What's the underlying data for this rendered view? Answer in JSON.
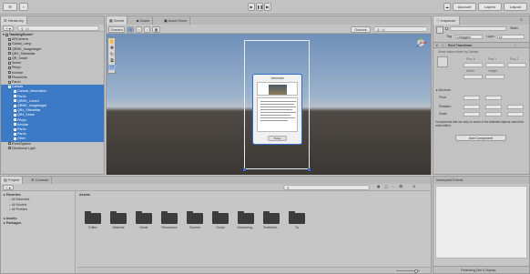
{
  "toolbar": {
    "account_label": "Account",
    "layers_label": "Layers",
    "layout_label": "Layout",
    "play_icon": "play-icon",
    "pause_icon": "pause-icon",
    "step_icon": "step-icon"
  },
  "hierarchy": {
    "tab_label": "Hierarchy",
    "search_placeholder": "All",
    "scene_name": "TrackingScene*",
    "items": [
      {
        "label": "ARCamera",
        "selected": false
      },
      {
        "label": "Global_Lamp",
        "selected": false
      },
      {
        "label": "QRMK_Imagetarget",
        "selected": false
      },
      {
        "label": "QR4_Sitebeldar",
        "selected": false
      },
      {
        "label": "QR_Sobar",
        "selected": false
      },
      {
        "label": "Scene",
        "selected": false
      },
      {
        "label": "Plinyu",
        "selected": false
      },
      {
        "label": "Kovidar",
        "selected": false
      },
      {
        "label": "Pimachine",
        "selected": false
      },
      {
        "label": "Pardu",
        "selected": false
      },
      {
        "label": "Canvas",
        "selected": true
      },
      {
        "label": "Canvas_Information",
        "selected": true
      },
      {
        "label": "Pardu",
        "selected": true
      },
      {
        "label": "QRMK_Lorzen",
        "selected": true
      },
      {
        "label": "QRMK_Imagetarget",
        "selected": true
      },
      {
        "label": "QR4_Sitebeldar",
        "selected": true
      },
      {
        "label": "QR4_Sobar",
        "selected": true
      },
      {
        "label": "Plinyu",
        "selected": true
      },
      {
        "label": "Kovidar",
        "selected": true
      },
      {
        "label": "Pardu",
        "selected": true
      },
      {
        "label": "Pardu",
        "selected": true
      },
      {
        "label": "Other",
        "selected": true
      },
      {
        "label": "EventSystem",
        "selected": false
      },
      {
        "label": "Directional Light",
        "selected": false
      }
    ]
  },
  "scene_view": {
    "tabs": [
      "Scene",
      "Game",
      "Asset Store"
    ],
    "active_tab": "Scene",
    "mode_label": "Shaded",
    "dim_label": "2D",
    "gizmos_label": "Gizmos",
    "search_placeholder": "All",
    "card_title": "Informasi",
    "card_button": "Tutup"
  },
  "inspector": {
    "tab_label": "Inspector",
    "static_label": "Static",
    "tag_label": "Tag",
    "tag_value": "Untagged",
    "layer_label": "Layer",
    "layer_value": "UI",
    "component_title": "Rect Transform",
    "notice": "Some values driven by Canvas.",
    "fields": [
      "Pos X",
      "Pos Y",
      "Pos Z",
      "Width",
      "Height"
    ],
    "anchors_label": "Anchors",
    "pivot_label": "Pivot",
    "rotation_label": "Rotation",
    "scale_label": "Scale",
    "warning": "Components that are only on some of the selected objects cannot be multi-edited.",
    "add_component": "Add Component"
  },
  "project": {
    "tabs": [
      "Project",
      "Console"
    ],
    "tree": [
      {
        "label": "Favorites",
        "indent": 0,
        "bold": true
      },
      {
        "label": "All Materials",
        "indent": 1,
        "bold": false
      },
      {
        "label": "All Models",
        "indent": 1,
        "bold": false
      },
      {
        "label": "All Prefabs",
        "indent": 1,
        "bold": false
      },
      {
        "label": "Assets",
        "indent": 0,
        "bold": true
      },
      {
        "label": "Packages",
        "indent": 0,
        "bold": true
      }
    ],
    "breadcrumb": "Assets",
    "folders": [
      "Editor",
      "Material",
      "Mode",
      "Resources",
      "Scenes",
      "Script",
      "Streaming...",
      "TextMesh...",
      "Tu"
    ],
    "count_label": "11"
  },
  "interrupted": {
    "title": "Interrupted Events",
    "footer": "Previewing (Veri 5, Buyma)"
  }
}
